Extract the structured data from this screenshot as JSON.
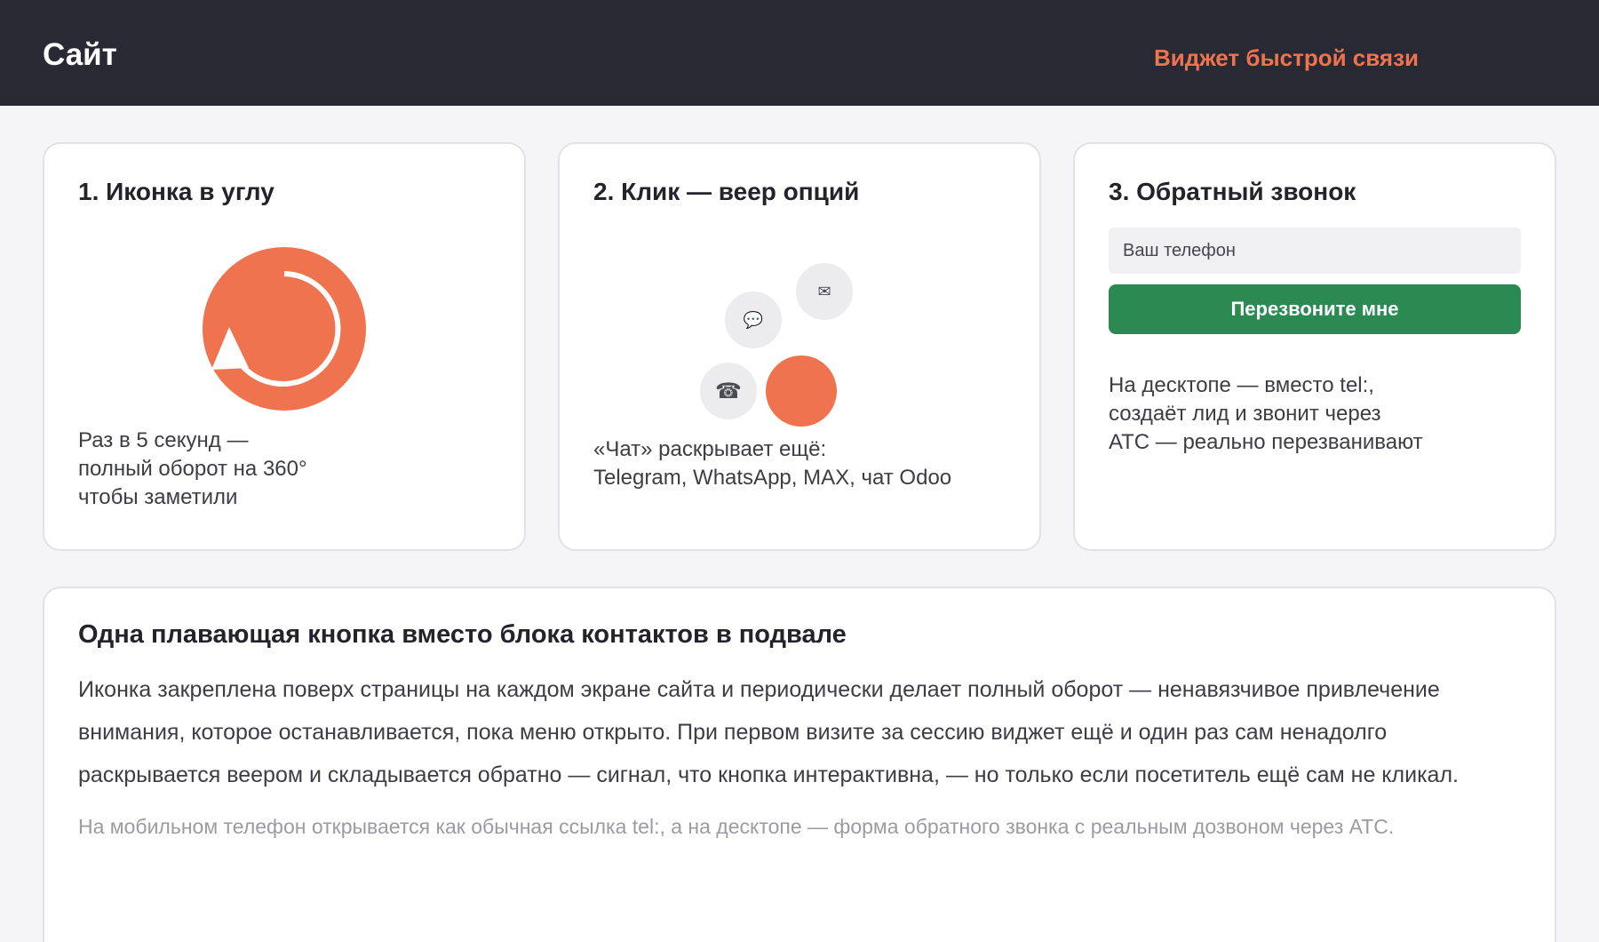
{
  "header": {
    "brand": "Сайт",
    "link": "Виджет быстрой связи"
  },
  "colors": {
    "accent": "#f07350",
    "header_bg": "#282933",
    "button_green": "#2a8a52"
  },
  "cards": [
    {
      "title": "1. Иконка в углу",
      "desc": [
        "Раз в 5 секунд —",
        "полный оборот на 360°",
        "чтобы заметили"
      ]
    },
    {
      "title": "2. Клик — веер опций",
      "icons": {
        "mail": "✉",
        "chat": "💬",
        "phone": "☎"
      },
      "desc": [
        "«Чат» раскрывает ещё:",
        "Telegram, WhatsApp, MAX, чат Odoo"
      ]
    },
    {
      "title": "3. Обратный звонок",
      "input_placeholder": "Ваш телефон",
      "button": "Перезвоните мне",
      "desc": [
        "На десктопе — вместо tel:,",
        "создаёт лид и звонит через",
        "АТС — реально перезванивают"
      ]
    }
  ],
  "info": {
    "title": "Одна плавающая кнопка вместо блока контактов в подвале",
    "body": "Иконка закреплена поверх страницы на каждом экране сайта и периодически делает полный оборот — ненавязчивое привлечение внимания, которое останавливается, пока меню открыто. При первом визите за сессию виджет ещё и один раз сам ненадолго раскрывается веером и складывается обратно — сигнал, что кнопка интерактивна, — но только если посетитель ещё сам не кликал.",
    "note": "На мобильном телефон открывается как обычная ссылка tel:, а на десктопе — форма обратного звонка с реальным дозвоном через АТС."
  }
}
